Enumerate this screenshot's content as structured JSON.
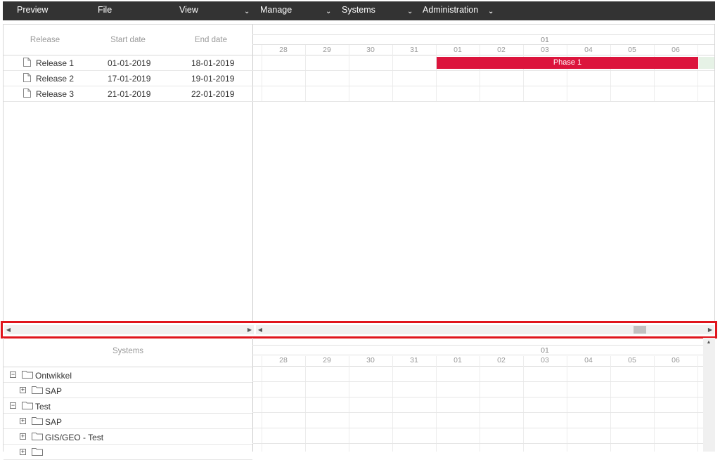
{
  "menu": {
    "items": [
      {
        "label": "Preview",
        "has_dropdown": false
      },
      {
        "label": "File",
        "has_dropdown": true
      },
      {
        "label": "View",
        "has_dropdown": true
      },
      {
        "label": "Manage",
        "has_dropdown": true
      },
      {
        "label": "Systems",
        "has_dropdown": true
      },
      {
        "label": "Administration",
        "has_dropdown": true
      }
    ],
    "chevron": "⌄"
  },
  "releases": {
    "columns": [
      "Release",
      "Start date",
      "End date"
    ],
    "rows": [
      {
        "name": "Release 1",
        "start": "01-01-2019",
        "end": "18-01-2019"
      },
      {
        "name": "Release 2",
        "start": "17-01-2019",
        "end": "19-01-2019"
      },
      {
        "name": "Release 3",
        "start": "21-01-2019",
        "end": "22-01-2019"
      }
    ]
  },
  "timeline": {
    "month": "01",
    "days": [
      "28",
      "29",
      "30",
      "31",
      "01",
      "02",
      "03",
      "04",
      "05",
      "06"
    ]
  },
  "phase": {
    "label": "Phase 1",
    "release": "Release 1",
    "color": "#dc143c"
  },
  "systems": {
    "header": "Systems",
    "tree": [
      {
        "label": "Ontwikkel",
        "level": 0,
        "expanded": true
      },
      {
        "label": "SAP",
        "level": 1,
        "expanded": false
      },
      {
        "label": "Test",
        "level": 0,
        "expanded": true
      },
      {
        "label": "SAP",
        "level": 1,
        "expanded": false
      },
      {
        "label": "GIS/GEO - Test",
        "level": 1,
        "expanded": false
      },
      {
        "label": "",
        "level": 1,
        "expanded": false
      }
    ]
  },
  "colors": {
    "menubar": "#333333",
    "highlight": "#e0151d",
    "phase": "#dc143c"
  }
}
